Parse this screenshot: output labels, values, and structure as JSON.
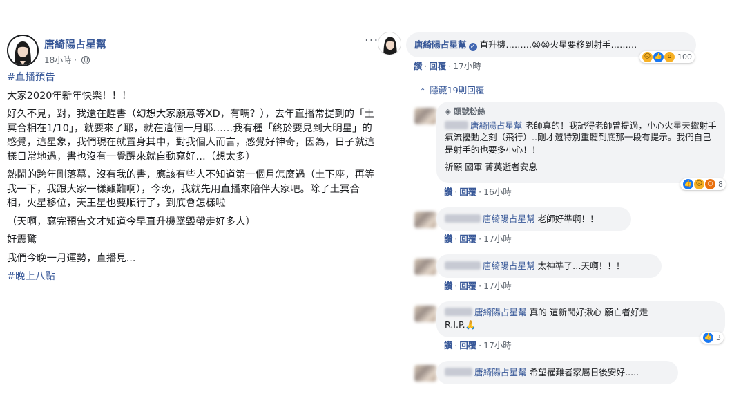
{
  "post": {
    "page_name": "唐綺陽占星幫",
    "time": "18小時",
    "more": "···",
    "paragraphs": [
      {
        "text": "#直播預告",
        "hashtag": true
      },
      {
        "text": "大家2020年新年快樂！！！"
      },
      {
        "text": "好久不見，對，我還在趕書（幻想大家願意等XD，有嗎？），去年直播常提到的「土冥合相在1/10」，就要來了耶，就在這個一月耶……我有種「終於要見到大明星」的感覺，這星象，我們現在就置身其中，對我個人而言，感覺好神奇，因為，日子就這樣日常地過，書也沒有一覺醒來就自動寫好…（想太多）"
      },
      {
        "text": "熱鬧的跨年剛落幕，沒有我的書，應該有些人不知道第一個月怎麼過（土下座，再等我一下，我跟大家一樣艱難啊），今晚，我就先用直播來陪伴大家吧。除了土冥合相，火星移位，天王星也要順行了，到底會怎樣啦"
      },
      {
        "text": "（天啊，寫完預告文才知道今早直升機墜毀帶走好多人）"
      },
      {
        "text": "好震驚"
      },
      {
        "text": "我們今晚一月運勢，直播見..."
      },
      {
        "text": "#晚上八點",
        "hashtag": true
      }
    ]
  },
  "comments": {
    "main": {
      "name": "唐綺陽占星幫",
      "text": "直升機………😫😫火星要移到射手………",
      "like": "讚",
      "reply": "回覆",
      "time": "17小時",
      "reactions": "100"
    },
    "hidden_replies": "隱藏19則回覆",
    "replies": [
      {
        "badge": "頭號粉絲",
        "tag": "唐綺陽占星幫",
        "text": "老師真的！我記得老師曾提過，小心火星天蠍射手氣流擾動之刻（飛行）..剛才還特別重聽到底那一段有提示。我們自己是射手的也要多小心！！",
        "extra": "祈願 國軍 菁英逝者安息",
        "like": "讚",
        "reply": "回覆",
        "time": "16小時",
        "reactions": "8"
      },
      {
        "tag": "唐綺陽占星幫",
        "text": "老師好準啊！！",
        "like": "讚",
        "reply": "回覆",
        "time": "17小時"
      },
      {
        "tag": "唐綺陽占星幫",
        "text": "太神準了…天啊！！！",
        "like": "讚",
        "reply": "回覆",
        "time": "17小時"
      },
      {
        "tag": "唐綺陽占星幫",
        "text": "真的 這新聞好揪心 願亡者好走",
        "extra": "R.I.P.🙏",
        "like": "讚",
        "reply": "回覆",
        "time": "17小時",
        "reactions": "3"
      },
      {
        "tag": "唐綺陽占星幫",
        "text": "希望罹難者家屬日後安好....."
      }
    ]
  },
  "colors": {
    "link": "#385898",
    "bubble": "#f2f3f5",
    "meta": "#606770",
    "like_blue": "#1877f2"
  }
}
